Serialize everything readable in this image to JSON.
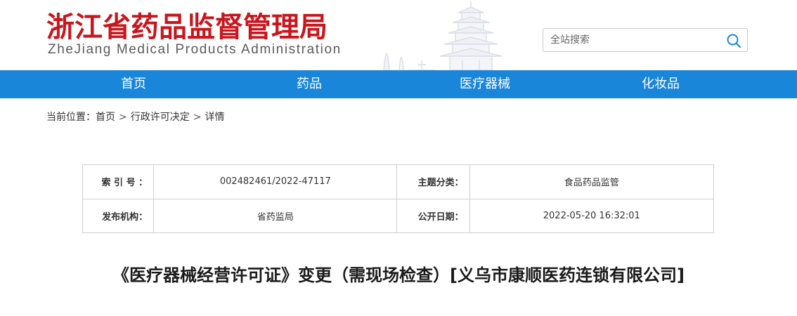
{
  "header": {
    "title": "浙江省药品监督管理局",
    "subtitle": "ZheJiang Medical Products Administration",
    "search": {
      "placeholder": "全站搜索",
      "value": ""
    }
  },
  "nav": {
    "items": [
      {
        "label": "首页"
      },
      {
        "label": "药品"
      },
      {
        "label": "医疗器械"
      },
      {
        "label": "化妆品"
      }
    ],
    "color": "#1a86d9"
  },
  "breadcrumb": {
    "prefix": "当前位置：",
    "items": [
      "首页",
      "行政许可决定",
      "详情"
    ],
    "separator": ">"
  },
  "meta": {
    "index_label": "索 引 号 ：",
    "index_value": "002482461/2022-47117",
    "category_label": "主题分类：",
    "category_value": "食品药品监管",
    "publisher_label": "发布机构：",
    "publisher_value": "省药监局",
    "date_label": "公开日期：",
    "date_value": "2022-05-20 16:32:01"
  },
  "article": {
    "title": "《医疗器械经营许可证》变更（需现场检查）[义乌市康顺医药连锁有限公司]"
  },
  "colors": {
    "brand_red": "#c9161d",
    "nav_blue": "#1a86d9"
  }
}
